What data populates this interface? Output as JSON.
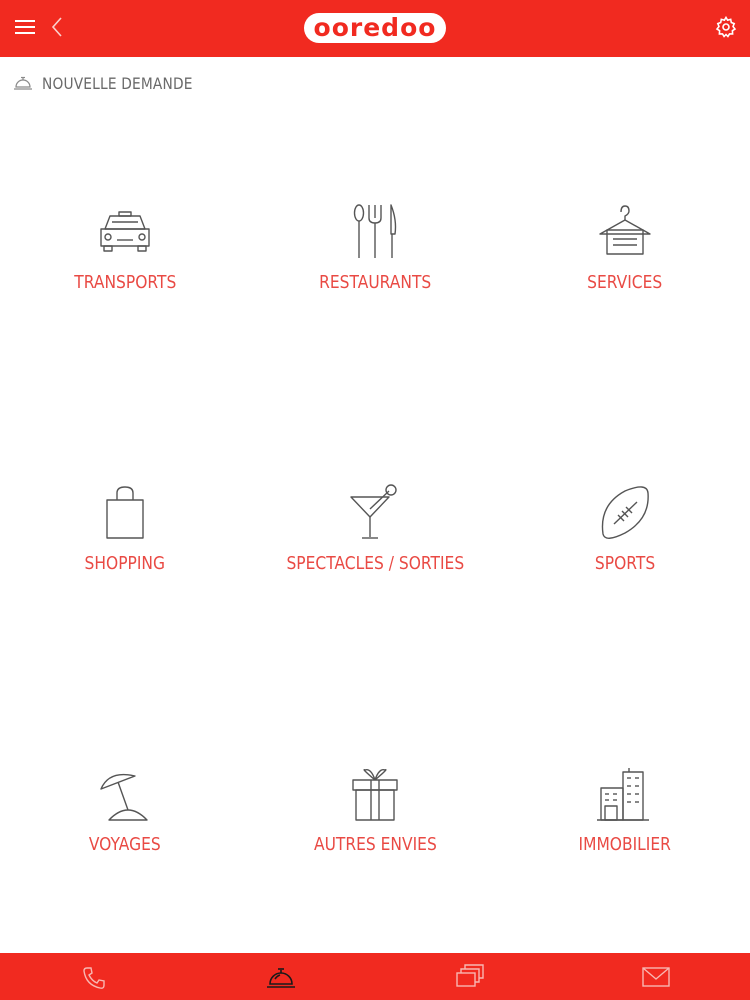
{
  "header": {
    "logo_text": "ooredoo",
    "menu_icon": "hamburger-menu-icon",
    "back_icon": "chevron-left-icon",
    "settings_icon": "gear-icon",
    "bar_color": "#f12a20"
  },
  "subheader": {
    "icon": "concierge-bell-icon",
    "title": "NOUVELLE DEMANDE"
  },
  "categories": [
    {
      "label": "TRANSPORTS",
      "icon": "taxi-icon"
    },
    {
      "label": "RESTAURANTS",
      "icon": "cutlery-icon"
    },
    {
      "label": "SERVICES",
      "icon": "hanger-icon"
    },
    {
      "label": "SHOPPING",
      "icon": "shopping-bag-icon"
    },
    {
      "label": "SPECTACLES / SORTIES",
      "icon": "cocktail-icon"
    },
    {
      "label": "SPORTS",
      "icon": "football-icon"
    },
    {
      "label": "VOYAGES",
      "icon": "beach-umbrella-icon"
    },
    {
      "label": "AUTRES ENVIES",
      "icon": "gift-icon"
    },
    {
      "label": "IMMOBILIER",
      "icon": "buildings-icon"
    }
  ],
  "bottom_nav": [
    {
      "icon": "phone-icon",
      "active": false
    },
    {
      "icon": "concierge-bell-icon",
      "active": true
    },
    {
      "icon": "cards-stack-icon",
      "active": false
    },
    {
      "icon": "envelope-icon",
      "active": false
    }
  ],
  "colors": {
    "accent": "#f12a20",
    "label": "#e94a44",
    "icon_stroke": "#555555"
  }
}
